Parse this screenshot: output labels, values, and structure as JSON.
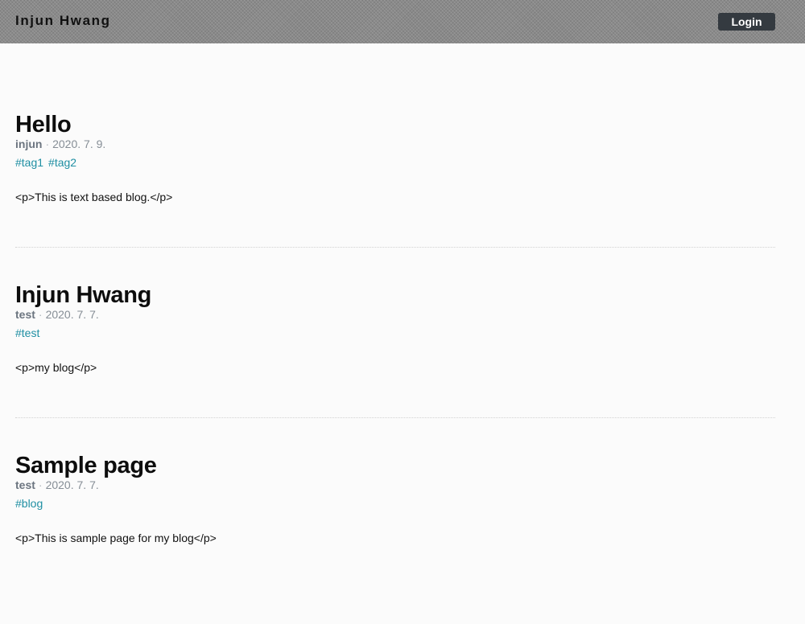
{
  "header": {
    "site_title": "Injun Hwang",
    "login_label": "Login"
  },
  "posts": [
    {
      "title": "Hello",
      "author": "injun",
      "separator": "·",
      "date": "2020. 7. 9.",
      "tags": [
        "#tag1",
        "#tag2"
      ],
      "body": "<p>This is text based blog.</p>"
    },
    {
      "title": "Injun Hwang",
      "author": "test",
      "separator": "·",
      "date": "2020. 7. 7.",
      "tags": [
        "#test"
      ],
      "body": "<p>my blog</p>"
    },
    {
      "title": "Sample page",
      "author": "test",
      "separator": "·",
      "date": "2020. 7. 7.",
      "tags": [
        "#blog"
      ],
      "body": "<p>This is sample page for my blog</p>"
    }
  ]
}
